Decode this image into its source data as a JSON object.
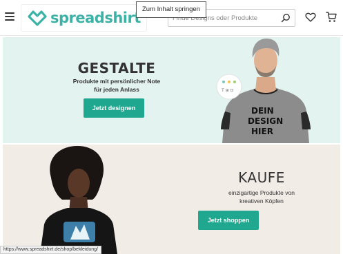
{
  "header": {
    "logo_text": "spreadshirt",
    "skip_link": "Zum Inhalt springen",
    "search_placeholder": "Finde Designs oder Produkte"
  },
  "hero_design": {
    "title": "GESTALTE",
    "subtitle_line1": "Produkte mit persönlicher Note",
    "subtitle_line2": "für jeden Anlass",
    "button": "Jetzt designen",
    "shirt_text_line1": "DEIN",
    "shirt_text_line2": "DESIGN",
    "shirt_text_line3": "HIER"
  },
  "hero_shop": {
    "title": "KAUFE",
    "subtitle_line1": "einzigartige Produkte von",
    "subtitle_line2": "kreativen Köpfen",
    "button": "Jetzt shoppen"
  },
  "status_bar": {
    "url": "https://www.spreadshirt.de/shop/bekleidung/"
  },
  "colors": {
    "brand": "#3bb2a6",
    "button": "#1fa88f",
    "banner1_bg": "#e3f3ef",
    "banner2_bg": "#f2ece7"
  },
  "icons": [
    "menu-icon",
    "logo-icon",
    "search-icon",
    "heart-icon",
    "cart-icon"
  ]
}
